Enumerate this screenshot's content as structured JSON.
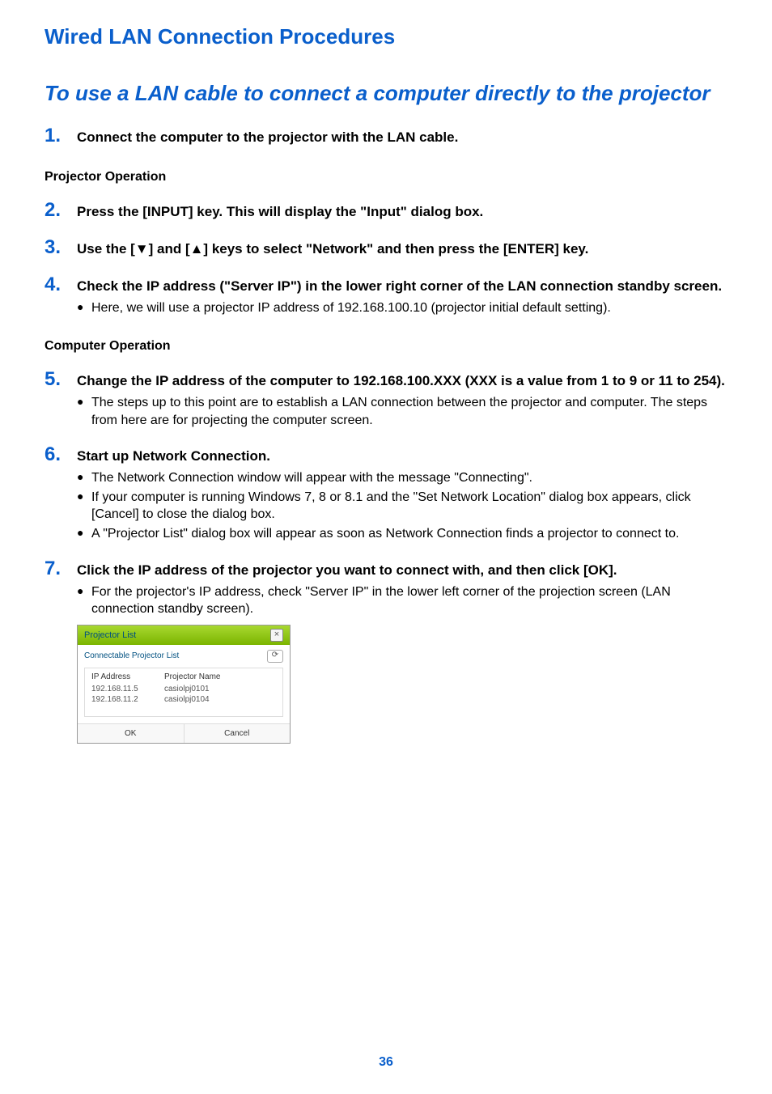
{
  "mainHeading": "Wired LAN Connection Procedures",
  "subHeading": "To use a LAN cable to connect a computer directly to the projector",
  "steps": {
    "s1": {
      "num": "1.",
      "text": "Connect the computer to the projector with the LAN cable."
    },
    "s2": {
      "num": "2.",
      "text": "Press the [INPUT] key. This will display the \"Input\" dialog box."
    },
    "s3": {
      "num": "3.",
      "text": "Use the [▼] and [▲] keys to select \"Network\" and then press the [ENTER] key."
    },
    "s4": {
      "num": "4.",
      "text": "Check the IP address (\"Server IP\") in the lower right corner of the LAN connection standby screen.",
      "bullets": [
        "Here, we will use a projector IP address of 192.168.100.10 (projector initial default setting)."
      ]
    },
    "s5": {
      "num": "5.",
      "text": "Change the IP address of the computer to 192.168.100.XXX (XXX is a value from 1 to 9 or 11 to 254).",
      "bullets": [
        "The steps up to this point are to establish a LAN connection between the projector and computer. The steps from here are for projecting the computer screen."
      ]
    },
    "s6": {
      "num": "6.",
      "text": "Start up Network Connection.",
      "bullets": [
        "The Network Connection window will appear with the message \"Connecting\".",
        "If your computer is running Windows 7, 8 or 8.1 and the \"Set Network Location\" dialog box appears, click [Cancel] to close the dialog box.",
        "A \"Projector List\" dialog box will appear as soon as Network Connection finds a projector to connect to."
      ]
    },
    "s7": {
      "num": "7.",
      "text": "Click the IP address of the projector you want to connect with, and then click [OK].",
      "bullets": [
        "For the projector's IP address, check \"Server IP\" in the lower left corner of the projection screen (LAN connection standby screen)."
      ]
    }
  },
  "labels": {
    "projectorOperation": "Projector Operation",
    "computerOperation": "Computer Operation"
  },
  "dialog": {
    "title": "Projector List",
    "subTitle": "Connectable Projector List",
    "col1": "IP Address",
    "col2": "Projector Name",
    "rows": [
      {
        "ip": "192.168.11.5",
        "name": "casiolpj0101"
      },
      {
        "ip": "192.168.11.2",
        "name": "casiolpj0104"
      }
    ],
    "ok": "OK",
    "cancel": "Cancel"
  },
  "pageNumber": "36"
}
